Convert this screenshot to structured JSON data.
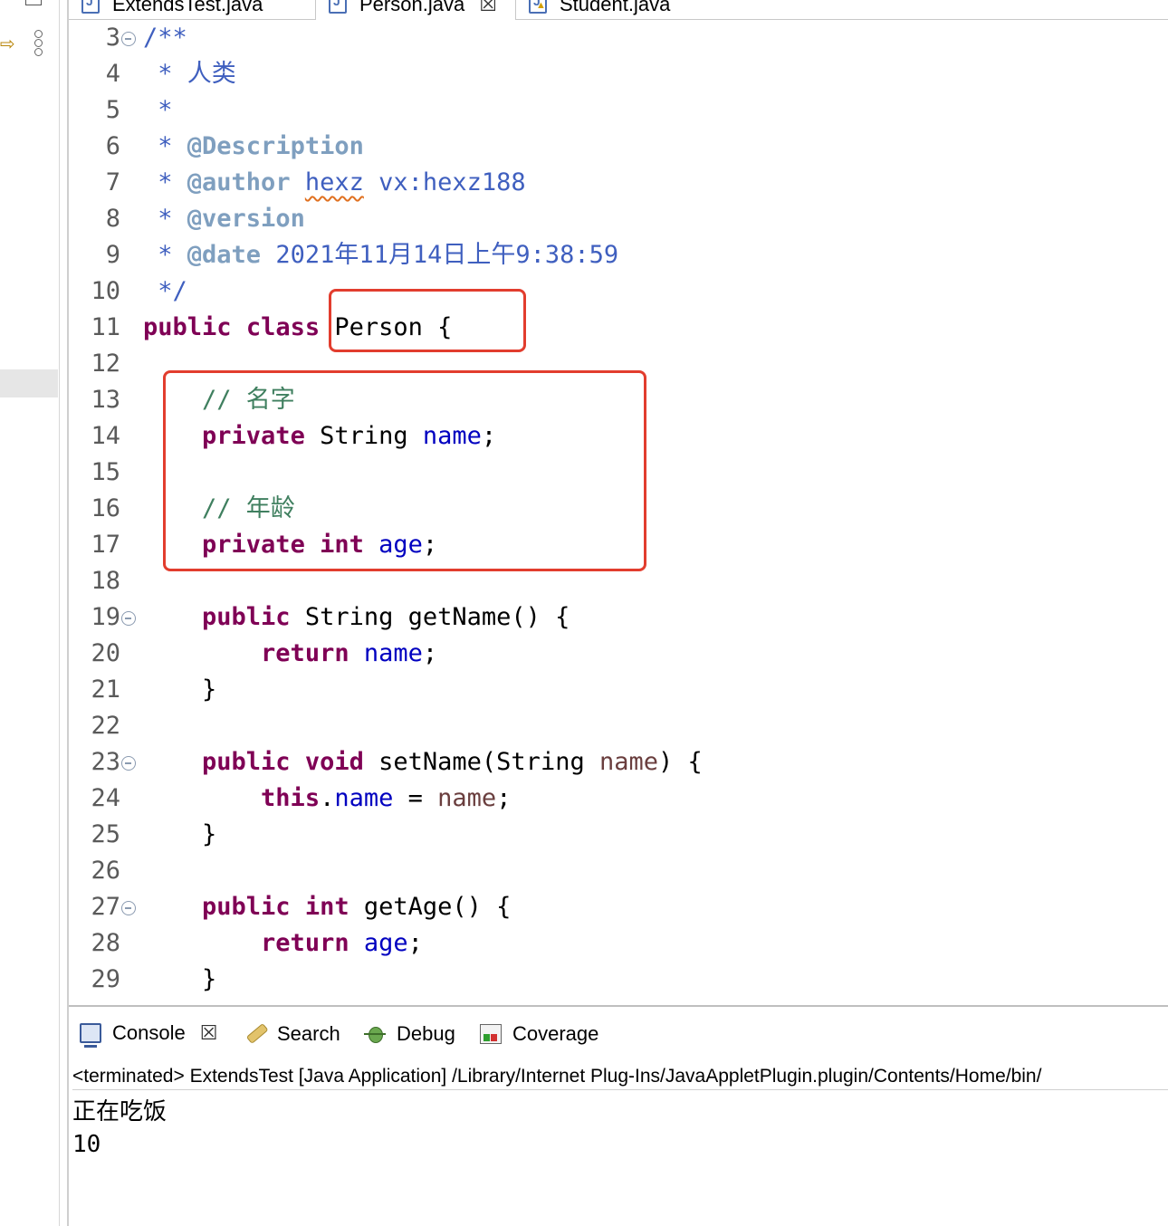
{
  "tabs": [
    {
      "label": "ExtendsTest.java",
      "active": false
    },
    {
      "label": "Person.java",
      "active": true
    },
    {
      "label": "Student.java",
      "active": false,
      "warning": true
    }
  ],
  "editor": {
    "lines": [
      {
        "num": "3",
        "fold": true,
        "segments": [
          {
            "cls": "doc",
            "text": "/**"
          }
        ]
      },
      {
        "num": "4",
        "segments": [
          {
            "cls": "doc",
            "text": " * 人类"
          }
        ]
      },
      {
        "num": "5",
        "segments": [
          {
            "cls": "doc",
            "text": " *"
          }
        ]
      },
      {
        "num": "6",
        "segments": [
          {
            "cls": "doc",
            "text": " * "
          },
          {
            "cls": "doctag",
            "text": "@Description"
          }
        ]
      },
      {
        "num": "7",
        "segments": [
          {
            "cls": "doc",
            "text": " * "
          },
          {
            "cls": "doctag",
            "text": "@author"
          },
          {
            "cls": "doc",
            "text": " "
          },
          {
            "cls": "doc squig",
            "text": "hexz"
          },
          {
            "cls": "doc",
            "text": " vx:hexz188"
          }
        ]
      },
      {
        "num": "8",
        "segments": [
          {
            "cls": "doc",
            "text": " * "
          },
          {
            "cls": "doctag",
            "text": "@version"
          }
        ]
      },
      {
        "num": "9",
        "segments": [
          {
            "cls": "doc",
            "text": " * "
          },
          {
            "cls": "doctag",
            "text": "@date"
          },
          {
            "cls": "doc",
            "text": " 2021年11月14日上午9:38:59"
          }
        ]
      },
      {
        "num": "10",
        "segments": [
          {
            "cls": "doc",
            "text": " */"
          }
        ]
      },
      {
        "num": "11",
        "segments": [
          {
            "cls": "kw",
            "text": "public"
          },
          {
            "cls": "plain",
            "text": " "
          },
          {
            "cls": "kw",
            "text": "class"
          },
          {
            "cls": "plain",
            "text": " Person {"
          }
        ]
      },
      {
        "num": "12",
        "segments": []
      },
      {
        "num": "13",
        "segments": [
          {
            "cls": "plain",
            "text": "    "
          },
          {
            "cls": "cmt",
            "text": "// 名字"
          }
        ]
      },
      {
        "num": "14",
        "segments": [
          {
            "cls": "plain",
            "text": "    "
          },
          {
            "cls": "kw",
            "text": "private"
          },
          {
            "cls": "plain",
            "text": " String "
          },
          {
            "cls": "fld",
            "text": "name"
          },
          {
            "cls": "plain",
            "text": ";"
          }
        ]
      },
      {
        "num": "15",
        "segments": []
      },
      {
        "num": "16",
        "segments": [
          {
            "cls": "plain",
            "text": "    "
          },
          {
            "cls": "cmt",
            "text": "// 年龄"
          }
        ]
      },
      {
        "num": "17",
        "segments": [
          {
            "cls": "plain",
            "text": "    "
          },
          {
            "cls": "kw",
            "text": "private"
          },
          {
            "cls": "plain",
            "text": " "
          },
          {
            "cls": "kw",
            "text": "int"
          },
          {
            "cls": "plain",
            "text": " "
          },
          {
            "cls": "fld",
            "text": "age"
          },
          {
            "cls": "plain",
            "text": ";"
          }
        ]
      },
      {
        "num": "18",
        "segments": []
      },
      {
        "num": "19",
        "fold": true,
        "segments": [
          {
            "cls": "plain",
            "text": "    "
          },
          {
            "cls": "kw",
            "text": "public"
          },
          {
            "cls": "plain",
            "text": " String getName() {"
          }
        ]
      },
      {
        "num": "20",
        "segments": [
          {
            "cls": "plain",
            "text": "        "
          },
          {
            "cls": "kw",
            "text": "return"
          },
          {
            "cls": "plain",
            "text": " "
          },
          {
            "cls": "fld",
            "text": "name"
          },
          {
            "cls": "plain",
            "text": ";"
          }
        ]
      },
      {
        "num": "21",
        "segments": [
          {
            "cls": "plain",
            "text": "    }"
          }
        ]
      },
      {
        "num": "22",
        "segments": []
      },
      {
        "num": "23",
        "fold": true,
        "segments": [
          {
            "cls": "plain",
            "text": "    "
          },
          {
            "cls": "kw",
            "text": "public"
          },
          {
            "cls": "plain",
            "text": " "
          },
          {
            "cls": "kw",
            "text": "void"
          },
          {
            "cls": "plain",
            "text": " setName(String "
          },
          {
            "cls": "par",
            "text": "name"
          },
          {
            "cls": "plain",
            "text": ") {"
          }
        ]
      },
      {
        "num": "24",
        "segments": [
          {
            "cls": "plain",
            "text": "        "
          },
          {
            "cls": "kw",
            "text": "this"
          },
          {
            "cls": "plain",
            "text": "."
          },
          {
            "cls": "fld",
            "text": "name"
          },
          {
            "cls": "plain",
            "text": " = "
          },
          {
            "cls": "par",
            "text": "name"
          },
          {
            "cls": "plain",
            "text": ";"
          }
        ]
      },
      {
        "num": "25",
        "segments": [
          {
            "cls": "plain",
            "text": "    }"
          }
        ]
      },
      {
        "num": "26",
        "segments": []
      },
      {
        "num": "27",
        "fold": true,
        "segments": [
          {
            "cls": "plain",
            "text": "    "
          },
          {
            "cls": "kw",
            "text": "public"
          },
          {
            "cls": "plain",
            "text": " "
          },
          {
            "cls": "kw",
            "text": "int"
          },
          {
            "cls": "plain",
            "text": " getAge() {"
          }
        ]
      },
      {
        "num": "28",
        "segments": [
          {
            "cls": "plain",
            "text": "        "
          },
          {
            "cls": "kw",
            "text": "return"
          },
          {
            "cls": "plain",
            "text": " "
          },
          {
            "cls": "fld",
            "text": "age"
          },
          {
            "cls": "plain",
            "text": ";"
          }
        ]
      },
      {
        "num": "29",
        "segments": [
          {
            "cls": "plain",
            "text": "    }"
          }
        ]
      }
    ]
  },
  "console": {
    "tabs": [
      {
        "label": "Console",
        "icon": "console-icon",
        "active": true,
        "closable": true
      },
      {
        "label": "Search",
        "icon": "search-icon"
      },
      {
        "label": "Debug",
        "icon": "debug-icon"
      },
      {
        "label": "Coverage",
        "icon": "coverage-icon"
      }
    ],
    "status": "<terminated> ExtendsTest [Java Application] /Library/Internet Plug-Ins/JavaAppletPlugin.plugin/Contents/Home/bin/",
    "output": [
      "正在吃饭",
      "10"
    ]
  },
  "colors": {
    "keyword": "#7f0055",
    "javadoc": "#3f5fbf",
    "javadoc_tag": "#7f9fbf",
    "comment": "#3f7f5f",
    "field": "#0000c0",
    "parameter": "#6a3e3e",
    "highlight_box": "#e23d2e"
  }
}
